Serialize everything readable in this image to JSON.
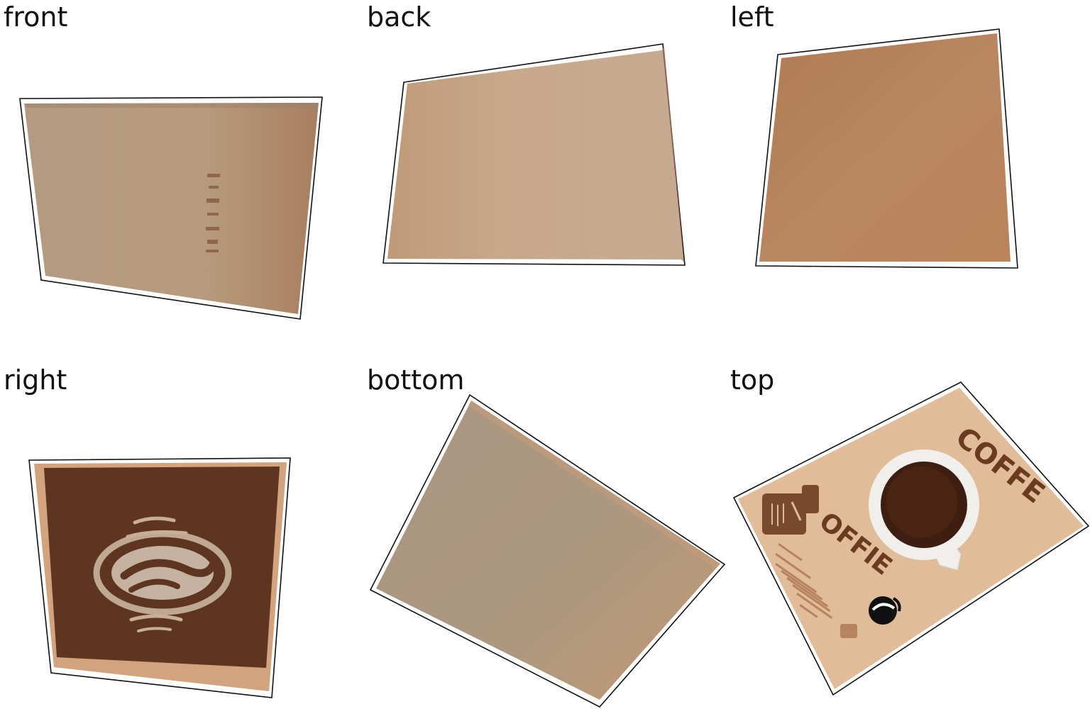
{
  "views": {
    "front": {
      "label": "front"
    },
    "back": {
      "label": "back"
    },
    "left": {
      "label": "left"
    },
    "right": {
      "label": "right"
    },
    "bottom": {
      "label": "bottom"
    },
    "top": {
      "label": "top"
    }
  },
  "colors": {
    "outline": "#111111",
    "front_face": "#b69c80",
    "back_face": "#c7a98c",
    "left_face": "#b98559",
    "right_face": "#5c3420",
    "right_rim": "#d6a47e",
    "bottom_face": "#ad977f",
    "top_face": "#e3bd98",
    "coffee_brown": "#6e3f24",
    "cup_white": "#f1efec",
    "coffee_liquid": "#4a2514"
  },
  "top_print": {
    "headline_1": "COFFE",
    "headline_2": "OFFIE"
  },
  "icons": {
    "coffee_bean": "coffee-bean-icon",
    "coffee_cup": "coffee-cup-icon",
    "price_tag": "tag-icon"
  }
}
